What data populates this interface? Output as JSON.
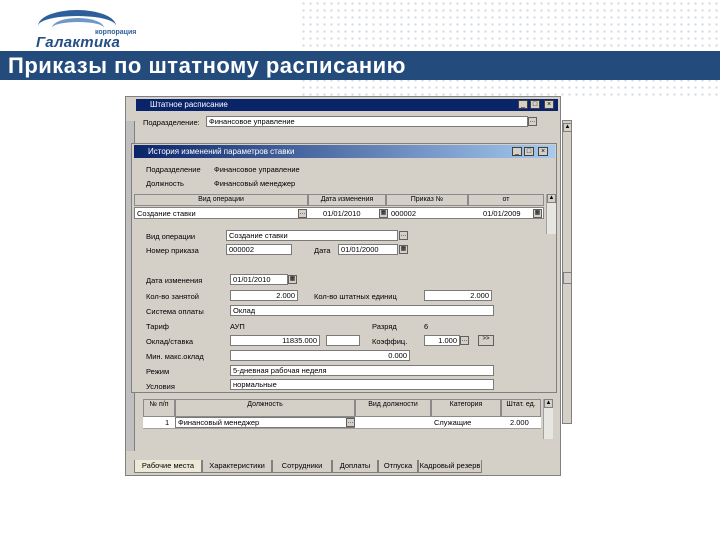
{
  "header": {
    "logo_corp": "корпорация",
    "logo_name": "Галактика",
    "slide_title": "Приказы по штатному расписанию"
  },
  "back_window": {
    "title": "Штатное расписание",
    "dept_label": "Подразделение:",
    "dept_value": "Финансовое управление",
    "grid_headers": [
      "№ п/п",
      "Должность",
      "Вид должности",
      "Категория",
      "Штат. ед."
    ],
    "row": {
      "num": "1",
      "position": "Финансовый менеджер",
      "kind": "",
      "category": "Служащие",
      "units": "2.000"
    },
    "tabs": [
      "Рабочие места",
      "Характеристики",
      "Сотрудники",
      "Доплаты",
      "Отпуска",
      "Кадровый резерв"
    ]
  },
  "front_window": {
    "title": "История изменений параметров ставки",
    "dept_label": "Подразделение",
    "dept_value": "Финансовое управление",
    "pos_label": "Должность",
    "pos_value": "Финансовый менеджер",
    "grid_headers": [
      "Вид операции",
      "Дата изменения",
      "Приказ №",
      "от"
    ],
    "grid_row": {
      "operation": "Создание ставки",
      "date": "01/01/2010",
      "order": "000002",
      "from": "01/01/2009"
    },
    "form": {
      "op_label": "Вид операции",
      "op_value": "Создание ставки",
      "order_label": "Номер приказа",
      "order_value": "000002",
      "date_label": "Дата",
      "date_value": "01/01/2000",
      "change_label": "Дата изменения",
      "change_value": "01/01/2010",
      "qty_label": "Кол-во занятой",
      "qty_value": "2.000",
      "units_label": "Кол-во штатных единиц",
      "units_value": "2.000",
      "pay_label": "Система оплаты",
      "pay_value": "Оклад",
      "tariff_label": "Тариф",
      "tariff_value": "АУП",
      "grade_label": "Разряд",
      "grade_value": "6",
      "salary_label": "Оклад/ставка",
      "salary_value": "11835.000",
      "coef_label": "Коэффиц.",
      "coef_value": "1.000",
      "max_label": "Мин. макс.оклад",
      "max_value": "0.000",
      "regime_label": "Режим",
      "regime_value": "5-дневная рабочая неделя",
      "cond_label": "Условия",
      "cond_value": "нормальные"
    }
  }
}
